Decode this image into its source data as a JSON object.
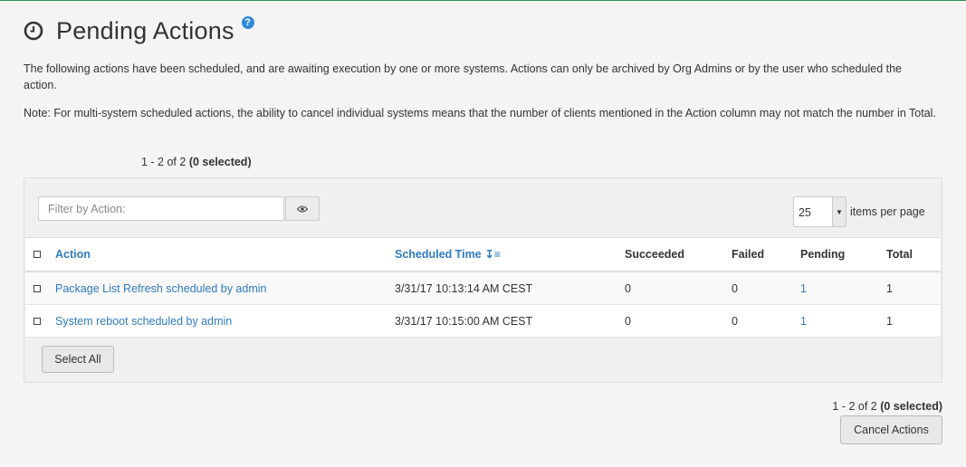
{
  "header": {
    "title": "Pending Actions",
    "clock_icon": "clock-icon",
    "help_icon": "help-icon",
    "help_glyph": "?"
  },
  "intro": {
    "p1": "The following actions have been scheduled, and are awaiting execution by one or more systems. Actions can only be archived by Org Admins or by the user who scheduled the action.",
    "p2": "Note: For multi-system scheduled actions, the ability to cancel individual systems means that the number of clients mentioned in the Action column may not match the number in Total."
  },
  "pager": {
    "range": "1 - 2 of 2",
    "selected": "(0 selected)"
  },
  "filter": {
    "placeholder": "Filter by Action:",
    "toggle_icon": "eye-icon"
  },
  "per_page": {
    "value": "25",
    "label": "items per page"
  },
  "table": {
    "columns": [
      "Action",
      "Scheduled Time",
      "Succeeded",
      "Failed",
      "Pending",
      "Total"
    ],
    "sort_icon": "sort-ascending-icon",
    "rows": [
      {
        "action": "Package List Refresh scheduled by admin",
        "time": "3/31/17 10:13:14 AM CEST",
        "succeeded": "0",
        "failed": "0",
        "pending": "1",
        "total": "1"
      },
      {
        "action": "System reboot scheduled by admin",
        "time": "3/31/17 10:15:00 AM CEST",
        "succeeded": "0",
        "failed": "0",
        "pending": "1",
        "total": "1"
      }
    ]
  },
  "buttons": {
    "select_all": "Select All",
    "cancel_actions": "Cancel Actions"
  },
  "colors": {
    "link": "#2d7bc0",
    "help": "#2e8ad8",
    "top_border": "#2e8b57"
  }
}
